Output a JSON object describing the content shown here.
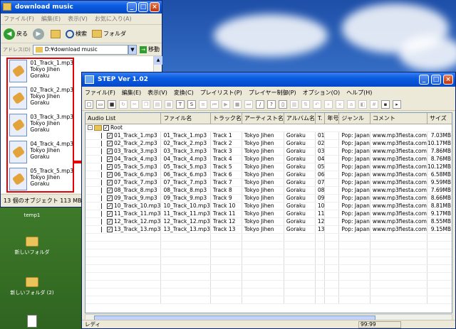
{
  "explorer": {
    "title": "download music",
    "menu": [
      "ファイル(F)",
      "編集(E)",
      "表示(V)",
      "お気に入り(A)"
    ],
    "toolbar": {
      "back": "戻る",
      "search": "検索",
      "folders": "フォルダ"
    },
    "address_label": "アドレス(D)",
    "address_value": "D:¥download music",
    "go_label": "移動",
    "files": [
      {
        "name": "01_Track_1.mp3",
        "artist": "Tokyo Jihen",
        "album": "Goraku"
      },
      {
        "name": "02_Track_2.mp3",
        "artist": "Tokyo Jihen",
        "album": "Goraku"
      },
      {
        "name": "03_Track_3.mp3",
        "artist": "Tokyo Jihen",
        "album": "Goraku"
      },
      {
        "name": "04_Track_4.mp3",
        "artist": "Tokyo Jihen",
        "album": "Goraku"
      },
      {
        "name": "05_Track_5.mp3",
        "artist": "Tokyo Jihen",
        "album": "Goraku"
      }
    ],
    "status": "13 個のオブジェクト 113 MB"
  },
  "desktop": {
    "icons": [
      "temp1",
      "新しいフォルダ",
      "新しいフォルダ (2)"
    ]
  },
  "step": {
    "title": "STEP Ver 1.02",
    "menu": [
      "ファイル(F)",
      "編集(E)",
      "表示(V)",
      "変換(C)",
      "プレイリスト(P)",
      "プレイヤー制御(P)",
      "オプション(O)",
      "ヘルプ(H)"
    ],
    "columns": [
      "Audio List",
      "ファイル名",
      "トラック名",
      "アーティスト名",
      "アルバム名",
      "T.",
      "年号",
      "ジャンル",
      "コメント",
      "サイズ"
    ],
    "root_label": "Root",
    "rows": [
      {
        "list": "01_Track_1.mp3",
        "file": "01_Track_1.mp3",
        "track": "Track 1",
        "artist": "Tokyo Jihen",
        "album": "Goraku",
        "t": "01",
        "year": "",
        "genre": "Pop: Japan",
        "comment": "www.mp3fiesta.com",
        "size": "7.03MB"
      },
      {
        "list": "02_Track_2.mp3",
        "file": "02_Track_2.mp3",
        "track": "Track 2",
        "artist": "Tokyo Jihen",
        "album": "Goraku",
        "t": "02",
        "year": "",
        "genre": "Pop: Japan",
        "comment": "www.mp3fiesta.com",
        "size": "10.17MB"
      },
      {
        "list": "03_Track_3.mp3",
        "file": "03_Track_3.mp3",
        "track": "Track 3",
        "artist": "Tokyo Jihen",
        "album": "Goraku",
        "t": "03",
        "year": "",
        "genre": "Pop: Japan",
        "comment": "www.mp3fiesta.com",
        "size": "7.86MB"
      },
      {
        "list": "04_Track_4.mp3",
        "file": "04_Track_4.mp3",
        "track": "Track 4",
        "artist": "Tokyo Jihen",
        "album": "Goraku",
        "t": "04",
        "year": "",
        "genre": "Pop: Japan",
        "comment": "www.mp3fiesta.com",
        "size": "8.76MB"
      },
      {
        "list": "05_Track_5.mp3",
        "file": "05_Track_5.mp3",
        "track": "Track 5",
        "artist": "Tokyo Jihen",
        "album": "Goraku",
        "t": "05",
        "year": "",
        "genre": "Pop: Japan",
        "comment": "www.mp3fiesta.com",
        "size": "10.12MB"
      },
      {
        "list": "06_Track_6.mp3",
        "file": "06_Track_6.mp3",
        "track": "Track 6",
        "artist": "Tokyo Jihen",
        "album": "Goraku",
        "t": "06",
        "year": "",
        "genre": "Pop: Japan",
        "comment": "www.mp3fiesta.com",
        "size": "6.58MB"
      },
      {
        "list": "07_Track_7.mp3",
        "file": "07_Track_7.mp3",
        "track": "Track 7",
        "artist": "Tokyo Jihen",
        "album": "Goraku",
        "t": "07",
        "year": "",
        "genre": "Pop: Japan",
        "comment": "www.mp3fiesta.com",
        "size": "9.59MB"
      },
      {
        "list": "08_Track_8.mp3",
        "file": "08_Track_8.mp3",
        "track": "Track 8",
        "artist": "Tokyo Jihen",
        "album": "Goraku",
        "t": "08",
        "year": "",
        "genre": "Pop: Japan",
        "comment": "www.mp3fiesta.com",
        "size": "7.69MB"
      },
      {
        "list": "09_Track_9.mp3",
        "file": "09_Track_9.mp3",
        "track": "Track 9",
        "artist": "Tokyo Jihen",
        "album": "Goraku",
        "t": "09",
        "year": "",
        "genre": "Pop: Japan",
        "comment": "www.mp3fiesta.com",
        "size": "8.66MB"
      },
      {
        "list": "10_Track_10.mp3",
        "file": "10_Track_10.mp3",
        "track": "Track 10",
        "artist": "Tokyo Jihen",
        "album": "Goraku",
        "t": "10",
        "year": "",
        "genre": "Pop: Japan",
        "comment": "www.mp3fiesta.com",
        "size": "8.81MB"
      },
      {
        "list": "11_Track_11.mp3",
        "file": "11_Track_11.mp3",
        "track": "Track 11",
        "artist": "Tokyo Jihen",
        "album": "Goraku",
        "t": "11",
        "year": "",
        "genre": "Pop: Japan",
        "comment": "www.mp3fiesta.com",
        "size": "9.17MB"
      },
      {
        "list": "12_Track_12.mp3",
        "file": "12_Track_12.mp3",
        "track": "Track 12",
        "artist": "Tokyo Jihen",
        "album": "Goraku",
        "t": "12",
        "year": "",
        "genre": "Pop: Japan",
        "comment": "www.mp3fiesta.com",
        "size": "8.55MB"
      },
      {
        "list": "13_Track_13.mp3",
        "file": "13_Track_13.mp3",
        "track": "Track 13",
        "artist": "Tokyo Jihen",
        "album": "Goraku",
        "t": "13",
        "year": "",
        "genre": "Pop: Japan",
        "comment": "www.mp3fiesta.com",
        "size": "9.15MB"
      }
    ],
    "status_left": "レディ",
    "status_cell": "99:99"
  },
  "colors": {
    "highlight": "#e60000",
    "xp_title": "#0a5ce0"
  }
}
